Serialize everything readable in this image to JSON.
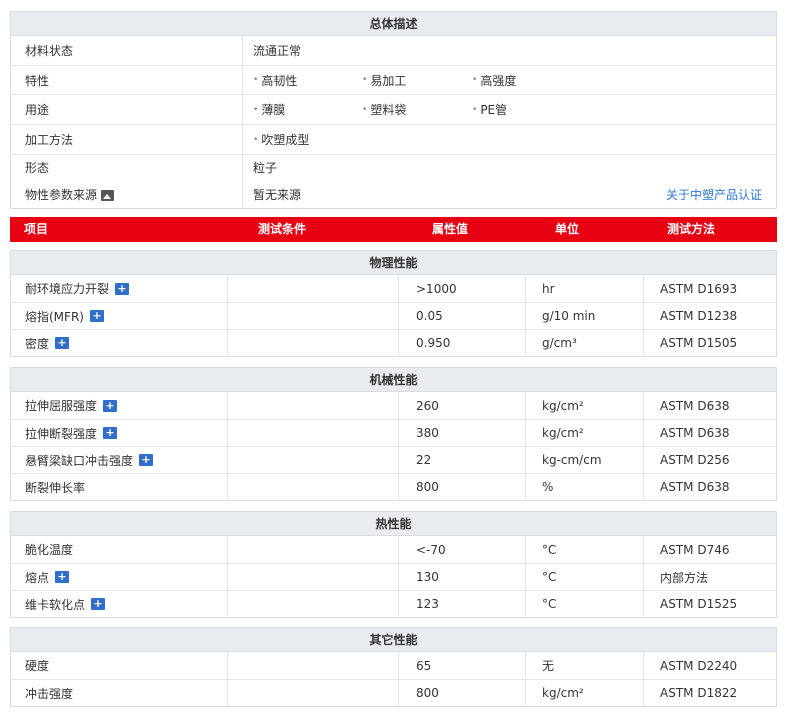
{
  "overview": {
    "title": "总体描述",
    "rows": [
      {
        "label": "材料状态",
        "value": "流通正常"
      },
      {
        "label": "特性",
        "items": [
          "高韧性",
          "易加工",
          "高强度"
        ]
      },
      {
        "label": "用途",
        "items": [
          "薄膜",
          "塑料袋",
          "PE管"
        ]
      },
      {
        "label": "加工方法",
        "items": [
          "吹塑成型"
        ]
      },
      {
        "label": "形态",
        "value": "粒子"
      },
      {
        "label": "物性参数来源",
        "value": "暂无来源",
        "link": "关于中塑产品认证",
        "icon": "image-icon"
      }
    ]
  },
  "columns": {
    "item": "项目",
    "condition": "测试条件",
    "value": "属性值",
    "unit": "单位",
    "method": "测试方法"
  },
  "physical": {
    "title": "物理性能",
    "rows": [
      {
        "name": "耐环境应力开裂",
        "cond": "",
        "value": ">1000",
        "unit": "hr",
        "method": "ASTM D1693",
        "icon": "plus-icon"
      },
      {
        "name": "熔指(MFR)",
        "cond": "",
        "value": "0.05",
        "unit": "g/10 min",
        "method": "ASTM D1238",
        "icon": "plus-icon"
      },
      {
        "name": "密度",
        "cond": "",
        "value": "0.950",
        "unit": "g/cm³",
        "method": "ASTM D1505",
        "icon": "plus-icon"
      }
    ]
  },
  "mechanical": {
    "title": "机械性能",
    "rows": [
      {
        "name": "拉伸屈服强度",
        "cond": "",
        "value": "260",
        "unit": "kg/cm²",
        "method": "ASTM D638",
        "icon": "plus-icon"
      },
      {
        "name": "拉伸断裂强度",
        "cond": "",
        "value": "380",
        "unit": "kg/cm²",
        "method": "ASTM D638",
        "icon": "plus-icon"
      },
      {
        "name": "悬臂梁缺口冲击强度",
        "cond": "",
        "value": "22",
        "unit": "kg-cm/cm",
        "method": "ASTM D256",
        "icon": "plus-icon"
      },
      {
        "name": "断裂伸长率",
        "cond": "",
        "value": "800",
        "unit": "%",
        "method": "ASTM D638"
      }
    ]
  },
  "thermal": {
    "title": "热性能",
    "rows": [
      {
        "name": "脆化温度",
        "cond": "",
        "value": "<-70",
        "unit": "°C",
        "method": "ASTM D746"
      },
      {
        "name": "熔点",
        "cond": "",
        "value": "130",
        "unit": "°C",
        "method": "内部方法",
        "icon": "plus-icon"
      },
      {
        "name": "维卡软化点",
        "cond": "",
        "value": "123",
        "unit": "°C",
        "method": "ASTM D1525",
        "icon": "plus-icon"
      }
    ]
  },
  "other": {
    "title": "其它性能",
    "rows": [
      {
        "name": "硬度",
        "cond": "",
        "value": "65",
        "unit": "无",
        "method": "ASTM D2240"
      },
      {
        "name": "冲击强度",
        "cond": "",
        "value": "800",
        "unit": "kg/cm²",
        "method": "ASTM D1822"
      }
    ]
  },
  "colors": {
    "header_red": "#e60012",
    "section_bg": "#e8ebf0",
    "link": "#2f78d4",
    "icon_blue": "#2f6fc9"
  }
}
